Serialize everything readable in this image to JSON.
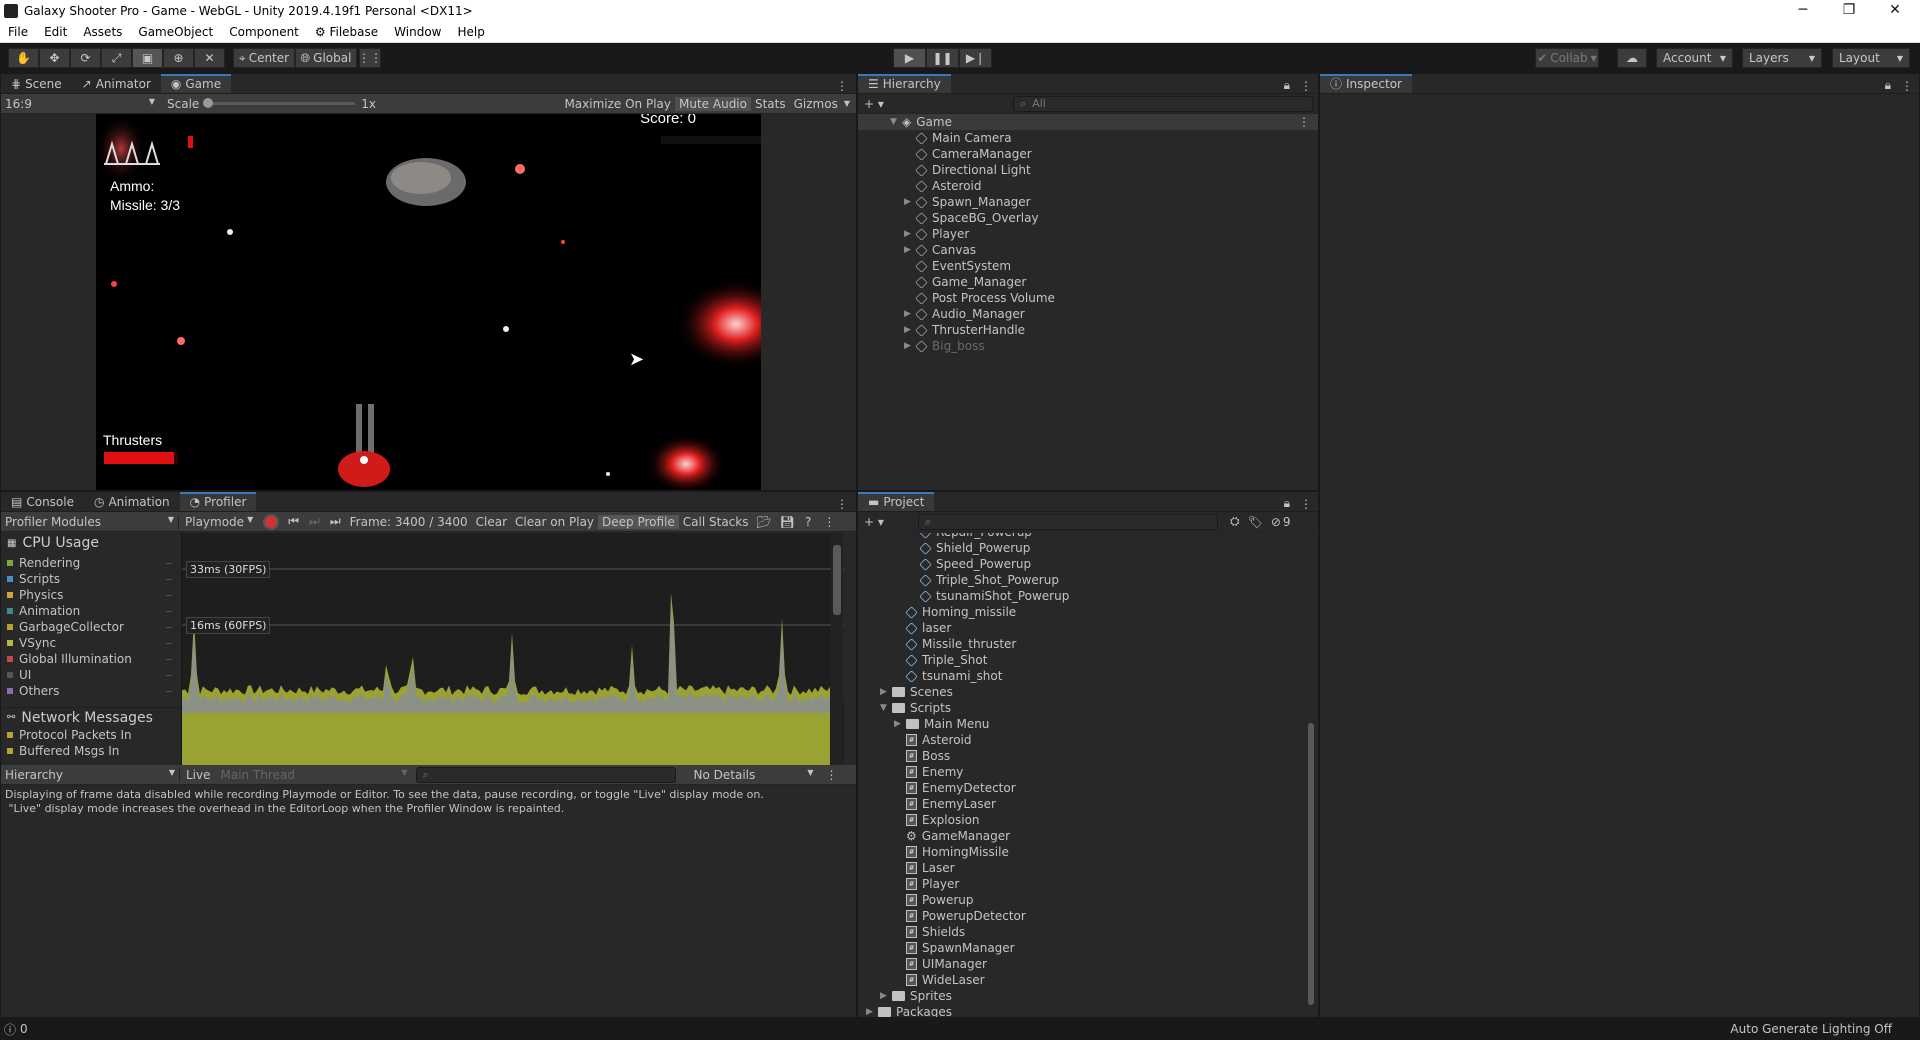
{
  "window": {
    "title": "Galaxy Shooter Pro - Game - WebGL - Unity 2019.4.19f1 Personal <DX11>",
    "minimize": "─",
    "maximize": "❐",
    "close": "✕"
  },
  "menu": [
    "File",
    "Edit",
    "Assets",
    "GameObject",
    "Component",
    "Filebase",
    "Window",
    "Help"
  ],
  "toolbar": {
    "pivot": "Center",
    "space": "Global",
    "collab": "Collab",
    "account": "Account",
    "layers": "Layers",
    "layout": "Layout"
  },
  "scene_tabs": {
    "scene": "Scene",
    "animator": "Animator",
    "game": "Game"
  },
  "game_bar": {
    "aspect": "16:9",
    "scale_label": "Scale",
    "scale_value": "1x",
    "maximize": "Maximize On Play",
    "mute": "Mute Audio",
    "stats": "Stats",
    "gizmos": "Gizmos"
  },
  "game_hud": {
    "score": "Score: 0",
    "ammo": "Ammo:",
    "missile": "Missile: 3/3",
    "thrusters": "Thrusters",
    "thruster_level": 0.95
  },
  "hierarchy": {
    "tab": "Hierarchy",
    "search_placeholder": "All",
    "scene": "Game",
    "items": [
      {
        "label": "Main Camera",
        "arrow": false,
        "disabled": false
      },
      {
        "label": "CameraManager",
        "arrow": false,
        "disabled": false
      },
      {
        "label": "Directional Light",
        "arrow": false,
        "disabled": false
      },
      {
        "label": "Asteroid",
        "arrow": false,
        "disabled": false
      },
      {
        "label": "Spawn_Manager",
        "arrow": true,
        "disabled": false
      },
      {
        "label": "SpaceBG_Overlay",
        "arrow": false,
        "disabled": false
      },
      {
        "label": "Player",
        "arrow": true,
        "disabled": false
      },
      {
        "label": "Canvas",
        "arrow": true,
        "disabled": false
      },
      {
        "label": "EventSystem",
        "arrow": false,
        "disabled": false
      },
      {
        "label": "Game_Manager",
        "arrow": false,
        "disabled": false
      },
      {
        "label": "Post Process Volume",
        "arrow": false,
        "disabled": false
      },
      {
        "label": "Audio_Manager",
        "arrow": true,
        "disabled": false
      },
      {
        "label": "ThrusterHandle",
        "arrow": true,
        "disabled": false
      },
      {
        "label": "Big_boss",
        "arrow": true,
        "disabled": true
      }
    ]
  },
  "inspector": {
    "tab": "Inspector"
  },
  "bottom_tabs": {
    "console": "Console",
    "animation": "Animation",
    "profiler": "Profiler"
  },
  "profiler": {
    "modules": "Profiler Modules",
    "playmode": "Playmode",
    "frame": "Frame: 3400 / 3400",
    "clear": "Clear",
    "clear_on_play": "Clear on Play",
    "deep_profile": "Deep Profile",
    "call_stacks": "Call Stacks",
    "cpu_title": "CPU Usage",
    "categories": [
      {
        "name": "Rendering",
        "color": "#7aa83c"
      },
      {
        "name": "Scripts",
        "color": "#4a8cc6"
      },
      {
        "name": "Physics",
        "color": "#d7a13a"
      },
      {
        "name": "Animation",
        "color": "#3c8c8c"
      },
      {
        "name": "GarbageCollector",
        "color": "#b5a33a"
      },
      {
        "name": "VSync",
        "color": "#b8b83c"
      },
      {
        "name": "Global Illumination",
        "color": "#b84c4c"
      },
      {
        "name": "UI",
        "color": "#555555"
      },
      {
        "name": "Others",
        "color": "#8c6cb0"
      }
    ],
    "label_33": "33ms (30FPS)",
    "label_16": "16ms (60FPS)",
    "net_title": "Network Messages",
    "net_items": [
      "Protocol Packets In",
      "Buffered Msgs In"
    ],
    "view": "Hierarchy",
    "live": "Live",
    "thread": "Main Thread",
    "details": "No Details",
    "message": "Displaying of frame data disabled while recording Playmode or Editor. To see the data, pause recording, or toggle \"Live\" display mode on.\n \"Live\" display mode increases the overhead in the EditorLoop when the Profiler Window is repainted."
  },
  "project": {
    "tab": "Project",
    "hidden_count": "9",
    "items": [
      {
        "label": "Repair_Powerup",
        "type": "prefab",
        "indent": 3,
        "arrow": ""
      },
      {
        "label": "Shield_Powerup",
        "type": "prefab",
        "indent": 3,
        "arrow": ""
      },
      {
        "label": "Speed_Powerup",
        "type": "prefab",
        "indent": 3,
        "arrow": ""
      },
      {
        "label": "Triple_Shot_Powerup",
        "type": "prefab",
        "indent": 3,
        "arrow": ""
      },
      {
        "label": "tsunamiShot_Powerup",
        "type": "prefab",
        "indent": 3,
        "arrow": ""
      },
      {
        "label": "Homing_missile",
        "type": "prefab",
        "indent": 2,
        "arrow": ""
      },
      {
        "label": "laser",
        "type": "prefab",
        "indent": 2,
        "arrow": ""
      },
      {
        "label": "Missile_thruster",
        "type": "prefab",
        "indent": 2,
        "arrow": ""
      },
      {
        "label": "Triple_Shot",
        "type": "prefab",
        "indent": 2,
        "arrow": ""
      },
      {
        "label": "tsunami_shot",
        "type": "prefab",
        "indent": 2,
        "arrow": ""
      },
      {
        "label": "Scenes",
        "type": "folder",
        "indent": 1,
        "arrow": "▶"
      },
      {
        "label": "Scripts",
        "type": "folder",
        "indent": 1,
        "arrow": "▼"
      },
      {
        "label": "Main Menu",
        "type": "folder",
        "indent": 2,
        "arrow": "▶"
      },
      {
        "label": "Asteroid",
        "type": "script",
        "indent": 2,
        "arrow": ""
      },
      {
        "label": "Boss",
        "type": "script",
        "indent": 2,
        "arrow": ""
      },
      {
        "label": "Enemy",
        "type": "script",
        "indent": 2,
        "arrow": ""
      },
      {
        "label": "EnemyDetector",
        "type": "script",
        "indent": 2,
        "arrow": ""
      },
      {
        "label": "EnemyLaser",
        "type": "script",
        "indent": 2,
        "arrow": ""
      },
      {
        "label": "Explosion",
        "type": "script",
        "indent": 2,
        "arrow": ""
      },
      {
        "label": "GameManager",
        "type": "gear",
        "indent": 2,
        "arrow": ""
      },
      {
        "label": "HomingMissile",
        "type": "script",
        "indent": 2,
        "arrow": ""
      },
      {
        "label": "Laser",
        "type": "script",
        "indent": 2,
        "arrow": ""
      },
      {
        "label": "Player",
        "type": "script",
        "indent": 2,
        "arrow": ""
      },
      {
        "label": "Powerup",
        "type": "script",
        "indent": 2,
        "arrow": ""
      },
      {
        "label": "PowerupDetector",
        "type": "script",
        "indent": 2,
        "arrow": ""
      },
      {
        "label": "Shields",
        "type": "script",
        "indent": 2,
        "arrow": ""
      },
      {
        "label": "SpawnManager",
        "type": "script",
        "indent": 2,
        "arrow": ""
      },
      {
        "label": "UIManager",
        "type": "script",
        "indent": 2,
        "arrow": ""
      },
      {
        "label": "WideLaser",
        "type": "script",
        "indent": 2,
        "arrow": ""
      },
      {
        "label": "Sprites",
        "type": "folder",
        "indent": 1,
        "arrow": "▶"
      },
      {
        "label": "Packages",
        "type": "folder",
        "indent": 0,
        "arrow": "▶"
      }
    ]
  },
  "status": {
    "count": "0",
    "lighting": "Auto Generate Lighting Off"
  }
}
